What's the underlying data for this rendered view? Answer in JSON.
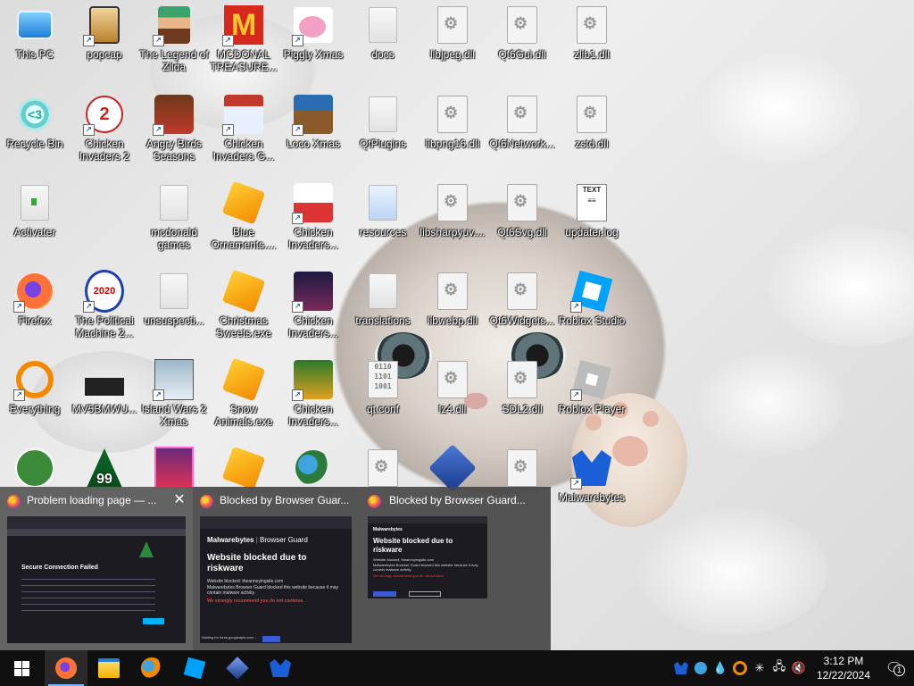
{
  "desktop": {
    "icons": [
      {
        "label": "This PC"
      },
      {
        "label": "popcap"
      },
      {
        "label": "The Legend of Zilda"
      },
      {
        "label": "MCDONAL TREASURE..."
      },
      {
        "label": "Piggly Xmas"
      },
      {
        "label": "docs"
      },
      {
        "label": "libjpeg.dll"
      },
      {
        "label": "Qt6Gui.dll"
      },
      {
        "label": "zlib1.dll"
      },
      {
        "label": "Recycle Bin"
      },
      {
        "label": "Chicken Invaders 2"
      },
      {
        "label": "Angry Birds Seasons"
      },
      {
        "label": "Chicken Invaders G..."
      },
      {
        "label": "Loco Xmas"
      },
      {
        "label": "QtPlugins"
      },
      {
        "label": "libpng16.dll"
      },
      {
        "label": "Qt6Network..."
      },
      {
        "label": "zstd.dll"
      },
      {
        "label": "Activater"
      },
      {
        "label": "mcdonald games"
      },
      {
        "label": "Blue Ornaments...."
      },
      {
        "label": "Chicken Invaders..."
      },
      {
        "label": "resources"
      },
      {
        "label": "libsharpyuv...."
      },
      {
        "label": "Qt6Svg.dll"
      },
      {
        "label": "updater.log"
      },
      {
        "label": "Firefox"
      },
      {
        "label": "The Political Machine 2..."
      },
      {
        "label": "unsuspecti..."
      },
      {
        "label": "Christmas Sweets.exe"
      },
      {
        "label": "Chicken Invaders..."
      },
      {
        "label": "translations"
      },
      {
        "label": "libwebp.dll"
      },
      {
        "label": "Qt6Widgets..."
      },
      {
        "label": "Roblox Studio"
      },
      {
        "label": "Everything"
      },
      {
        "label": "MV5BMWU..."
      },
      {
        "label": "Island Wars 2 Xmas"
      },
      {
        "label": "Snow Animals.exe"
      },
      {
        "label": "Chicken Invaders..."
      },
      {
        "label": "qt.conf"
      },
      {
        "label": "lz4.dll"
      },
      {
        "label": "SDL2.dll"
      },
      {
        "label": "Roblox Player"
      },
      {
        "label": "Malwarebytes"
      }
    ],
    "partial_icons": [
      "99"
    ]
  },
  "thumbnails": [
    {
      "title": "Problem loading page — ...",
      "heading": "Secure Connection Failed",
      "close": "✕"
    },
    {
      "title": "Blocked by Browser Guar...",
      "brand": "Malwarebytes",
      "product": "Browser Guard",
      "heading": "Website blocked due to riskware",
      "blocked_line": "Website blocked: theannoyingsite.com",
      "desc": "Malwarebytes Browser Guard blocked this website because it may contain malware activity.",
      "warning": "We strongly recommend you do not continue.",
      "footer": "Waiting for fonts.googleapis.com..."
    },
    {
      "title": "Blocked by Browser Guard...",
      "brand": "Malwarebytes",
      "heading": "Website blocked due to riskware",
      "blocked_line": "Website blocked: theannoyingsite.com",
      "desc": "Malwarebytes Browser Guard blocked this website because it may contain malware activity.",
      "warning": "We strongly recommend you do not continue."
    }
  ],
  "taskbar": {
    "time": "3:12 PM",
    "date": "12/22/2024",
    "notification_count": "1"
  },
  "colors": {
    "taskbar": "#101010",
    "firefox_orange": "#ff7139",
    "malwarebytes_blue": "#1a5fd6",
    "warning_red": "#e0443b"
  }
}
